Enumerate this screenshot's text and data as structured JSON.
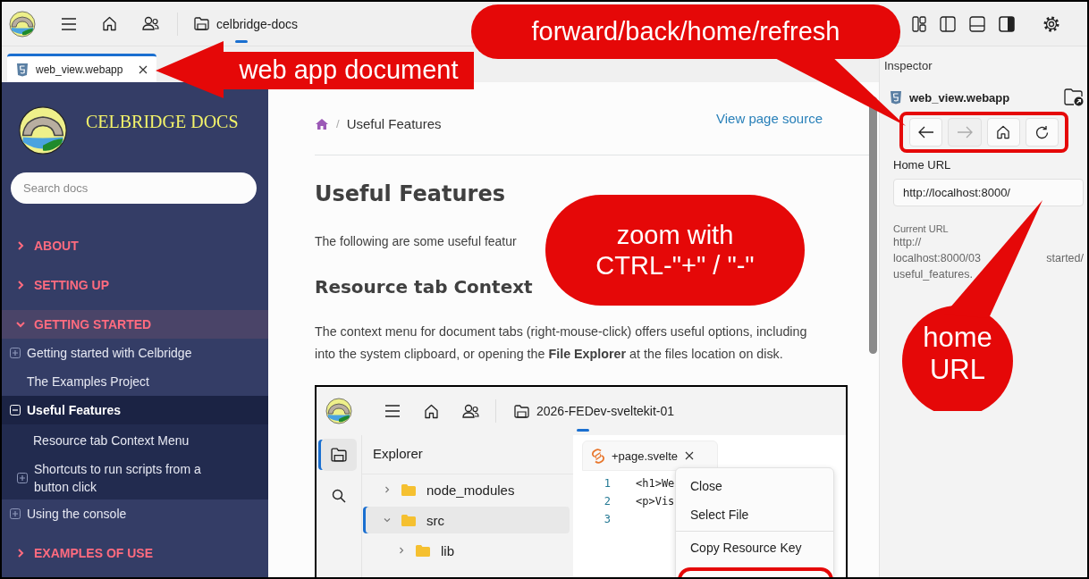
{
  "app_bar": {
    "project": "celbridge-docs"
  },
  "document_tabs": [
    {
      "label": "web_view.webapp",
      "selected": true
    }
  ],
  "docs_sidebar": {
    "title": "CELBRIDGE DOCS",
    "search": {
      "placeholder": "Search docs"
    },
    "nav": [
      {
        "kind": "section",
        "label": "ABOUT",
        "expanded": false
      },
      {
        "kind": "section",
        "label": "SETTING UP",
        "expanded": false
      },
      {
        "kind": "section",
        "label": "GETTING STARTED",
        "expanded": true,
        "children": [
          {
            "kind": "folder",
            "label": "Getting started with Celbridge",
            "expanded": false,
            "selected": false
          },
          {
            "kind": "page",
            "label": "The Examples Project",
            "selected": false
          },
          {
            "kind": "folder",
            "label": "Useful Features",
            "expanded": true,
            "selected": true,
            "children": [
              {
                "kind": "page",
                "label": "Resource tab Context Menu",
                "selected": false
              },
              {
                "kind": "folder",
                "label": "Shortcuts to run scripts from a button click",
                "expanded": false,
                "selected": false
              }
            ]
          },
          {
            "kind": "folder",
            "label": "Using the console",
            "expanded": false,
            "selected": false
          }
        ]
      },
      {
        "kind": "section",
        "label": "EXAMPLES OF USE",
        "expanded": false
      }
    ]
  },
  "page": {
    "breadcrumb": {
      "separator": "/",
      "current": "Useful Features"
    },
    "view_source_link": "View page source",
    "heading": "Useful Features",
    "intro": "The following are some useful featur",
    "section_heading": "Resource tab Context",
    "paragraph": "The context menu for document tabs (right-mouse-click) offers useful options, including\ninto the system clipboard, or opening the **File Explorer** at the files location on disk.",
    "screenshot": {
      "project": "2026-FEDev-sveltekit-01",
      "rail": [
        {
          "kind": "explorer",
          "selected": true
        },
        {
          "kind": "search",
          "selected": false
        }
      ],
      "explorer_title": "Explorer",
      "tree": [
        {
          "label": "node_modules",
          "expanded": false,
          "selected": false
        },
        {
          "label": "src",
          "expanded": true,
          "selected": true,
          "children": [
            {
              "label": "lib",
              "expanded": false,
              "selected": false
            }
          ]
        }
      ],
      "editor_tab": {
        "label": "+page.svelte",
        "selected": true
      },
      "code_lines": [
        {
          "number": "1",
          "text": "<h1>We"
        },
        {
          "number": "2",
          "text": "<p>Vis"
        },
        {
          "number": "3"
        }
      ],
      "context_menu": [
        {
          "kind": "item",
          "label": "Close"
        },
        {
          "kind": "item",
          "label": "Select File"
        },
        {
          "kind": "separator"
        },
        {
          "kind": "item",
          "label": "Copy Resource Key"
        }
      ]
    }
  },
  "inspector": {
    "title": "Inspector",
    "file": "web_view.webapp",
    "nav_buttons": [
      {
        "kind": "back",
        "disabled": false
      },
      {
        "kind": "forward",
        "disabled": true
      },
      {
        "kind": "home",
        "disabled": false
      },
      {
        "kind": "refresh",
        "disabled": false
      }
    ],
    "home_url": {
      "label": "Home URL",
      "value": "http://localhost:8000/"
    },
    "current_url": {
      "label": "Current URL",
      "lines": [
        [
          "http://"
        ],
        [
          "localhost:8000/03",
          "started/"
        ],
        [
          "useful_features."
        ]
      ]
    }
  },
  "annotations": [
    {
      "kind": "arrow",
      "text": "web app document"
    },
    {
      "kind": "bubble",
      "text": "forward/back/home/refresh"
    },
    {
      "kind": "pill",
      "text": "zoom with\nCTRL-\"+\" / \"-\""
    },
    {
      "kind": "round",
      "text": "home\nURL"
    }
  ]
}
